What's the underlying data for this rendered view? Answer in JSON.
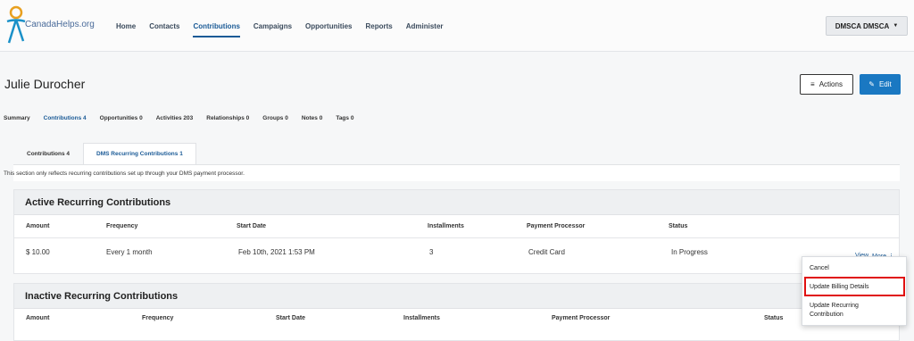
{
  "header": {
    "logo_text": "CanadaHelps.org",
    "nav": [
      "Home",
      "Contacts",
      "Contributions",
      "Campaigns",
      "Opportunities",
      "Reports",
      "Administer"
    ],
    "active_nav": "Contributions",
    "org_button": "DMSCA DMSCA"
  },
  "contact": {
    "name": "Julie Durocher",
    "actions_label": "Actions",
    "edit_label": "Edit"
  },
  "tabs": [
    "Summary",
    "Contributions 4",
    "Opportunities 0",
    "Activities 203",
    "Relationships 0",
    "Groups 0",
    "Notes 0",
    "Tags 0"
  ],
  "subtabs": [
    "Contributions 4",
    "DMS Recurring Contributions 1"
  ],
  "notice": "This section only reflects recurring contributions set up through your DMS payment processor.",
  "active": {
    "title": "Active Recurring Contributions",
    "columns": [
      "Amount",
      "Frequency",
      "Start Date",
      "Installments",
      "Payment Processor",
      "Status"
    ],
    "row": {
      "amount": "$ 10.00",
      "frequency": "Every 1 month",
      "start_date": "Feb 10th, 2021 1:53 PM",
      "installments": "3",
      "processor": "Credit Card",
      "status": "In Progress",
      "view": "View",
      "more": "More"
    }
  },
  "inactive": {
    "title": "Inactive Recurring Contributions",
    "columns": [
      "Amount",
      "Frequency",
      "Start Date",
      "Installments",
      "Payment Processor",
      "Status"
    ]
  },
  "dropdown": {
    "items": [
      "Cancel",
      "Update Billing Details",
      "Update Recurring",
      "Contribution"
    ]
  },
  "colors": {
    "accent": "#1a5a96",
    "edit_button": "#1a78c2",
    "highlight": "#e01010"
  }
}
